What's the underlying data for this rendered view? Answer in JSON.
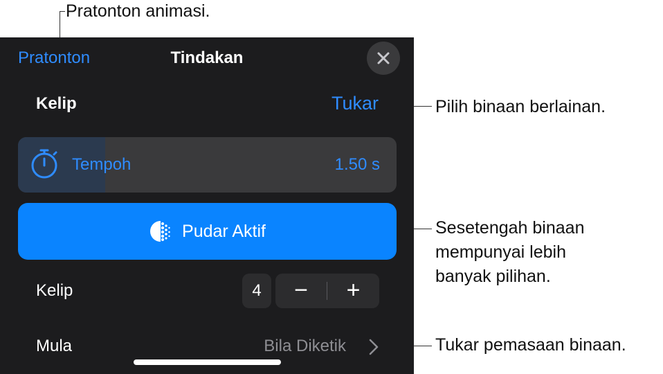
{
  "callouts": {
    "preview": "Pratonton animasi.",
    "change": "Pilih binaan berlainan.",
    "options_line1": "Sesetengah binaan",
    "options_line2": "mempunyai lebih",
    "options_line3": "banyak pilihan.",
    "order": "Tukar pemasaan binaan."
  },
  "header": {
    "preview_label": "Pratonton",
    "title": "Tindakan",
    "close_icon": "close-icon"
  },
  "clip_section": {
    "label": "Kelip",
    "change_label": "Tukar"
  },
  "duration": {
    "icon": "stopwatch-icon",
    "label": "Tempoh",
    "value": "1.50 s",
    "fill_fraction": 0.23
  },
  "effect": {
    "icon": "dissolve-icon",
    "label": "Pudar Aktif"
  },
  "clip_count": {
    "label": "Kelip",
    "value": "4",
    "minus": "−",
    "plus": "+"
  },
  "start": {
    "label": "Mula",
    "value": "Bila Diketik",
    "chevron_icon": "chevron-right-icon"
  },
  "colors": {
    "panel": "#1c1c1e",
    "accent": "#0a84ff",
    "link": "#2f8cff",
    "control": "#3a3a3c"
  }
}
